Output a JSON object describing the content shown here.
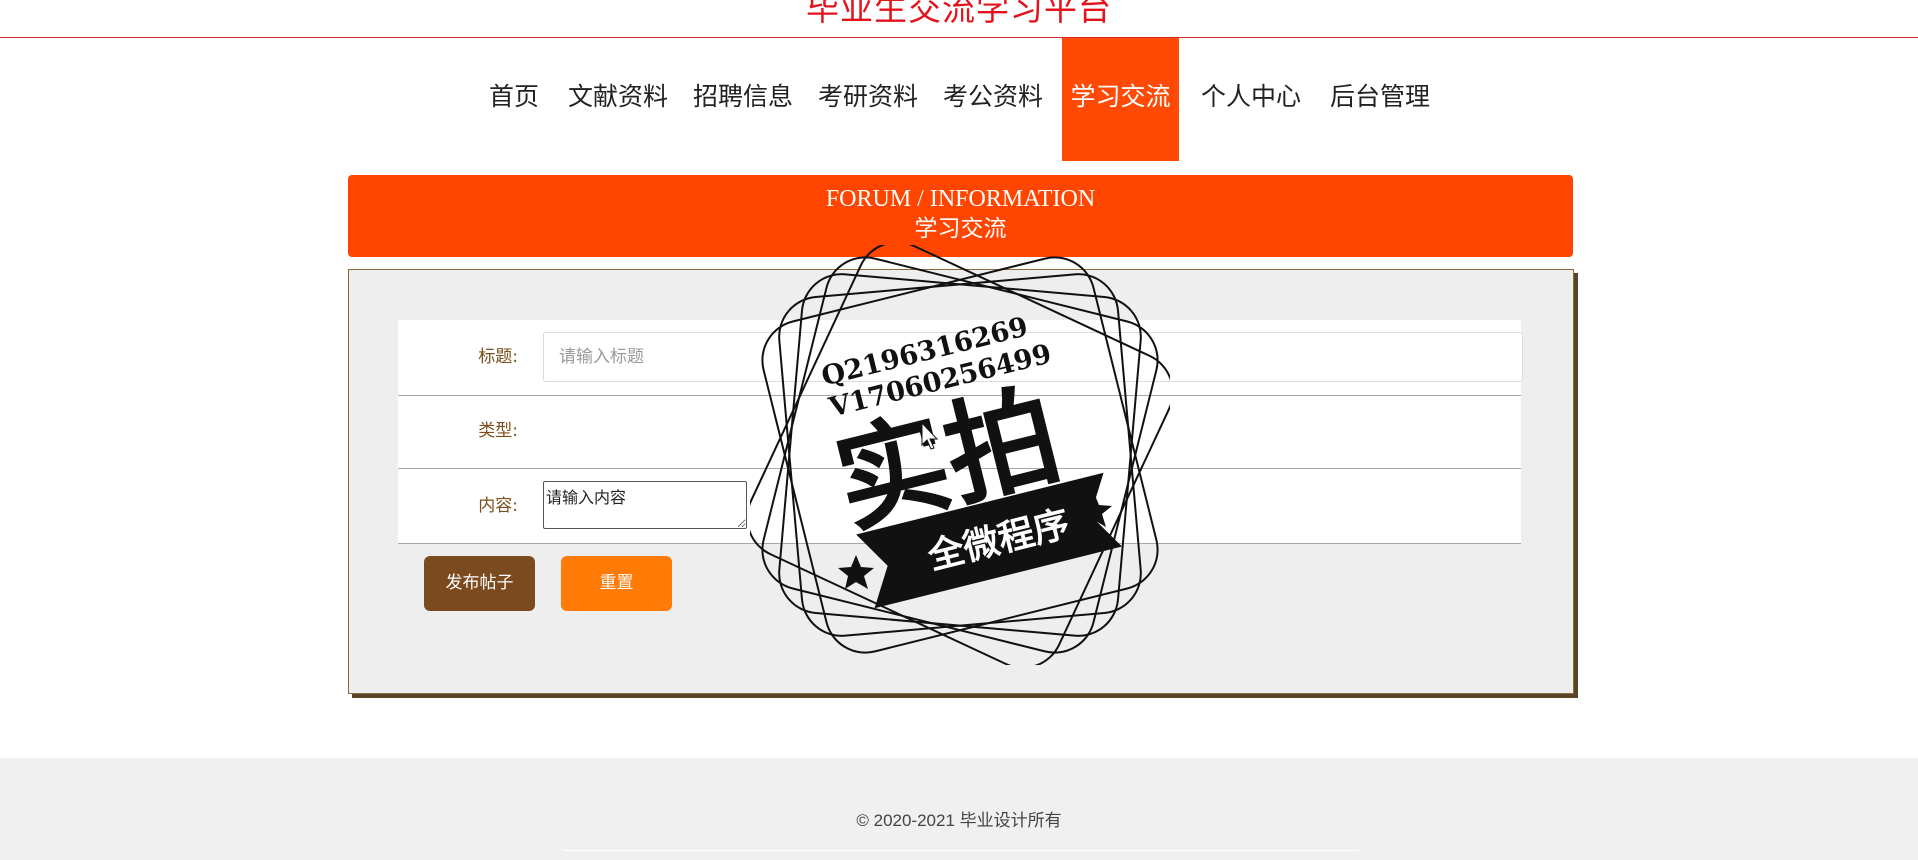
{
  "header": {
    "site_title": "毕业生交流学习平台"
  },
  "nav": {
    "items": [
      {
        "label": "首页"
      },
      {
        "label": "文献资料"
      },
      {
        "label": "招聘信息"
      },
      {
        "label": "考研资料"
      },
      {
        "label": "考公资料"
      },
      {
        "label": "学习交流"
      },
      {
        "label": "个人中心"
      },
      {
        "label": "后台管理"
      }
    ],
    "active": "学习交流",
    "active_color": "#ff4a06"
  },
  "banner": {
    "english": "FORUM / INFORMATION",
    "chinese": "学习交流",
    "color": "#ff4500"
  },
  "form": {
    "title_label": "标题:",
    "title_placeholder": "请输入标题",
    "title_value": "",
    "type_label": "类型:",
    "type_value": "",
    "content_label": "内容:",
    "content_placeholder": "请输入内容",
    "submit_label": "发布帖子",
    "reset_label": "重置",
    "submit_color": "#7b4a1e",
    "reset_color": "#ff7a07"
  },
  "watermark": {
    "qq": "Q2196316269",
    "wechat": "V17060256499",
    "main_text": "实拍",
    "ribbon_text": "全微程序"
  },
  "footer": {
    "copyright": "© 2020-2021 毕业设计所有"
  }
}
